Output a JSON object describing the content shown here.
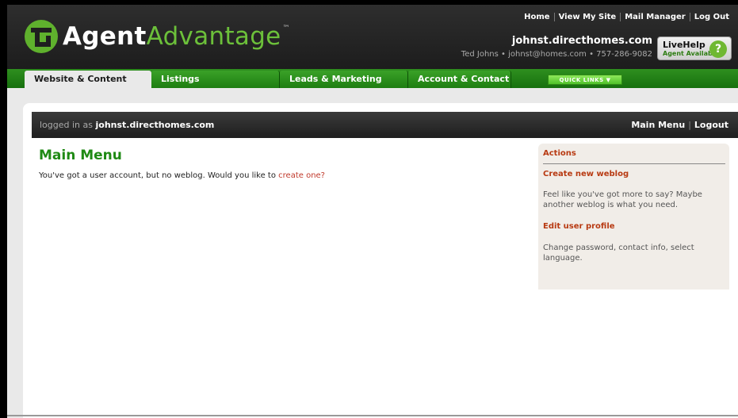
{
  "header": {
    "logo_agent": "Agent",
    "logo_advantage": "Advantage",
    "logo_tm": "™",
    "top_links": [
      "Home",
      "View My Site",
      "Mail Manager",
      "Log Out"
    ],
    "site_name": "johnst.directhomes.com",
    "user_info": "Ted Johns • johnst@homes.com • 757-286-9082",
    "livehelp_title": "LiveHelp",
    "livehelp_status": "Agent Available",
    "livehelp_icon": "?"
  },
  "nav": {
    "tabs": [
      "Website & Content",
      "Listings",
      "Leads & Marketing",
      "Account & Contact"
    ],
    "quick_links": "QUICK LINKS ▼"
  },
  "login_bar": {
    "prefix": "logged in as ",
    "user": "johnst.directhomes.com",
    "main_menu": "Main Menu",
    "separator": "|",
    "logout": "Logout"
  },
  "main": {
    "title": "Main Menu",
    "message": "You've got a user account, but no weblog. Would you like to ",
    "create_link": "create one?"
  },
  "actions": {
    "title": "Actions",
    "items": [
      {
        "label": "Create new weblog",
        "desc": "Feel like you've got more to say? Maybe another weblog is what you need."
      },
      {
        "label": "Edit user profile",
        "desc": "Change password, contact info, select language."
      }
    ]
  },
  "colors": {
    "brand_green": "#6cc03a",
    "nav_green": "#1f8a14",
    "link_red": "#b83a12"
  }
}
